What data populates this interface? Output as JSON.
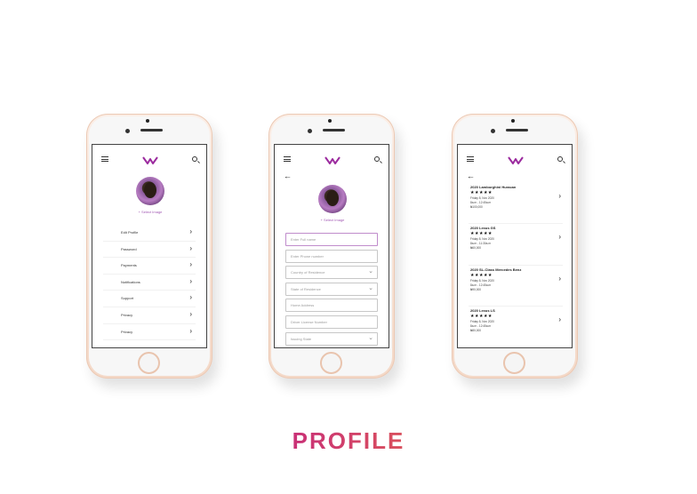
{
  "colors": {
    "accent": "#a35bb5",
    "brand_gradient": [
      "#9b1d8f",
      "#f59b2c"
    ]
  },
  "title": "PROFILE",
  "profile_screen": {
    "select_image": "+ Select Image",
    "menu": [
      {
        "label": "Edit Profile"
      },
      {
        "label": "Password"
      },
      {
        "label": "Payments"
      },
      {
        "label": "Notifications"
      },
      {
        "label": "Support"
      },
      {
        "label": "Privacy"
      },
      {
        "label": "Privacy"
      }
    ]
  },
  "form_screen": {
    "select_image": "+ Select Image",
    "fields": [
      {
        "placeholder": "Enter Full name"
      },
      {
        "placeholder": "Enter Phone number"
      },
      {
        "placeholder": "Country of Residence"
      },
      {
        "placeholder": "State of Residence"
      },
      {
        "placeholder": "Home Address"
      },
      {
        "placeholder": "Driver License Number"
      },
      {
        "placeholder": "Issuing State"
      }
    ]
  },
  "cars_screen": {
    "cars": [
      {
        "name": "2020 Lamborghini Huracan",
        "rating": "★★★★★",
        "date": "Friday 8, Nov 2020",
        "time": "8a.m - 12:45a.m",
        "price": "₦100,000"
      },
      {
        "name": "2020 Lexus GS",
        "rating": "★★★★★",
        "date": "Friday 8, Nov 2020",
        "time": "8a.m - 11:30a.m",
        "price": "₦60,000"
      },
      {
        "name": "2020 SL-Class Mercedes Benz",
        "rating": "★★★★★",
        "date": "Friday 8, Nov 2020",
        "time": "8a.m - 12:45a.m",
        "price": "₦90,000"
      },
      {
        "name": "2020 Lexus LS",
        "rating": "★★★★★",
        "date": "Friday 8, Nov 2020",
        "time": "8a.m - 12:45a.m",
        "price": "₦80,000"
      }
    ]
  }
}
